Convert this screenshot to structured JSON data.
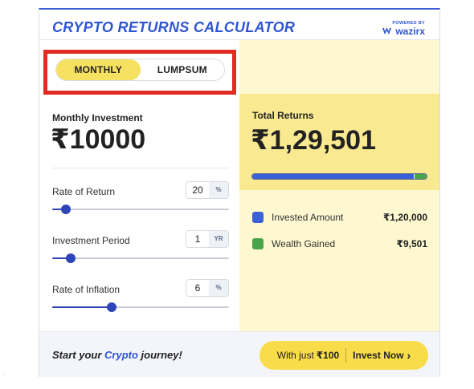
{
  "header": {
    "title": "CRYPTO RETURNS CALCULATOR",
    "powered_by": "POWERED BY",
    "brand_name": "wazirx",
    "brand_color": "#2f55d4"
  },
  "mode_toggle": {
    "options": [
      "MONTHLY",
      "LUMPSUM"
    ],
    "selected": "MONTHLY",
    "highlight_color": "#e22b22",
    "active_color": "#f7e160"
  },
  "inputs": {
    "investment_label": "Monthly Investment",
    "investment_value": "₹10000",
    "sliders": [
      {
        "label": "Rate of Return",
        "value": "20",
        "unit": "%",
        "position_fraction": 0.04
      },
      {
        "label": "Investment Period",
        "value": "1",
        "unit": "YR",
        "position_fraction": 0.07
      },
      {
        "label": "Rate of Inflation",
        "value": "6",
        "unit": "%",
        "position_fraction": 0.3
      }
    ]
  },
  "results": {
    "total_label": "Total Returns",
    "total_value": "₹1,29,501",
    "invested_fraction": 0.927,
    "legend": [
      {
        "label": "Invested Amount",
        "value": "₹1,20,000",
        "color": "#3b5fd6"
      },
      {
        "label": "Wealth Gained",
        "value": "₹9,501",
        "color": "#4aa54a"
      }
    ]
  },
  "footer": {
    "text_prefix": "Start your ",
    "text_highlight": "Crypto",
    "text_suffix": " journey!",
    "cta_prefix": "With just",
    "cta_amount": "₹100",
    "cta_action": "Invest Now",
    "cta_chevron": "›",
    "cta_color": "#f9dc4a"
  }
}
